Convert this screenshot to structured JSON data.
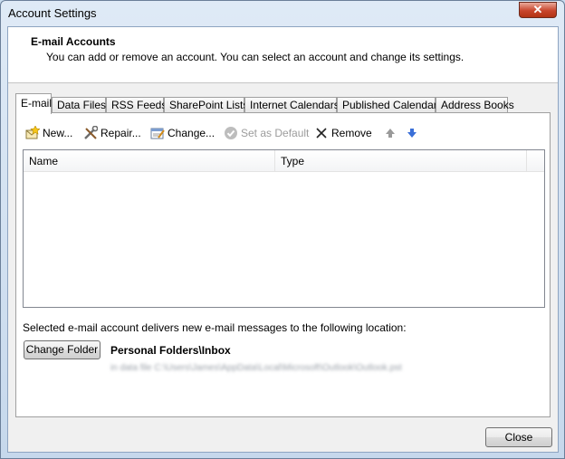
{
  "window": {
    "title": "Account Settings",
    "close_glyph": "✕"
  },
  "header": {
    "title": "E-mail Accounts",
    "description": "You can add or remove an account. You can select an account and change its settings."
  },
  "tabs": [
    {
      "label": "E-mail",
      "active": true
    },
    {
      "label": "Data Files"
    },
    {
      "label": "RSS Feeds"
    },
    {
      "label": "SharePoint Lists"
    },
    {
      "label": "Internet Calendars"
    },
    {
      "label": "Published Calendars"
    },
    {
      "label": "Address Books"
    }
  ],
  "toolbar": {
    "new_label": "New...",
    "repair_label": "Repair...",
    "change_label": "Change...",
    "set_default_label": "Set as Default",
    "remove_label": "Remove",
    "up_icon": "arrow-up-icon",
    "down_icon": "arrow-down-icon"
  },
  "accounts_list": {
    "columns": [
      "Name",
      "Type"
    ],
    "rows": []
  },
  "delivery": {
    "text": "Selected e-mail account delivers new e-mail messages to the following location:",
    "change_folder_label": "Change Folder",
    "folder_name": "Personal Folders\\Inbox",
    "data_file_path": "in data file C:\\Users\\James\\AppData\\Local\\Microsoft\\Outlook\\Outlook.pst"
  },
  "footer": {
    "close_label": "Close"
  },
  "colors": {
    "arrow_up": "#9a9a9a",
    "arrow_down": "#3a6fd8",
    "close_red": "#c8452c"
  }
}
